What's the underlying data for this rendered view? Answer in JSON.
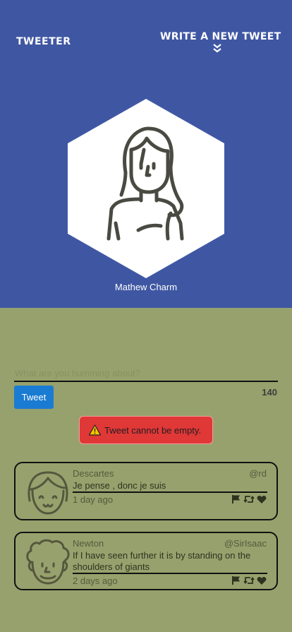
{
  "header": {
    "brand": "TWEETER",
    "compose_toggle_label": "WRITE A NEW TWEET",
    "background": "#3f57a3"
  },
  "profile": {
    "name": "Mathew Charm"
  },
  "compose": {
    "placeholder": "What are you humming about?",
    "value": "",
    "button_label": "Tweet",
    "char_count": "140"
  },
  "alert": {
    "message": "Tweet cannot be empty.",
    "color": "#e03737"
  },
  "tweets": [
    {
      "name": "Descartes",
      "handle": "@rd",
      "text": "Je pense , donc je suis",
      "date": "1 day ago"
    },
    {
      "name": "Newton",
      "handle": "@SirIsaac",
      "text": "If I have seen further it is by standing on the shoulders of giants",
      "date": "2 days ago"
    }
  ],
  "icons": [
    "chevron-double-down-icon",
    "warning-icon",
    "flag-icon",
    "retweet-icon",
    "heart-icon"
  ]
}
